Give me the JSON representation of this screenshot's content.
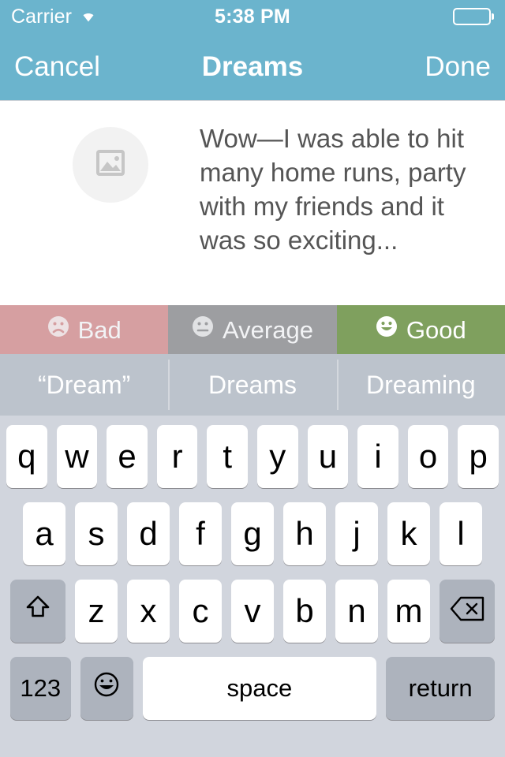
{
  "status_bar": {
    "carrier": "Carrier",
    "wifi_icon": "wifi-icon",
    "time": "5:38 PM",
    "battery_icon": "battery-full-icon",
    "background_color": "#6bb4cd"
  },
  "nav_bar": {
    "cancel_label": "Cancel",
    "title": "Dreams",
    "done_label": "Done",
    "background_color": "#6bb4cd"
  },
  "entry": {
    "avatar_icon": "photo-placeholder-icon",
    "text": "Wow—I was able to hit many home runs, party with my friends and it was so exciting..."
  },
  "rating_bar": {
    "options": [
      {
        "label": "Bad",
        "face": "frowning-face",
        "color": "#d98b8b",
        "selected": false
      },
      {
        "label": "Average",
        "face": "neutral-face",
        "color": "#8a8a8a",
        "selected": false
      },
      {
        "label": "Good",
        "face": "smiling-face",
        "color": "#7fa05e",
        "selected": true
      }
    ]
  },
  "suggestions": {
    "background_color": "#bcc3cc",
    "items": [
      "“Dream”",
      "Dreams",
      "Dreaming"
    ]
  },
  "keyboard": {
    "background_color": "#d1d5dd",
    "row1": [
      "q",
      "w",
      "e",
      "r",
      "t",
      "y",
      "u",
      "i",
      "o",
      "p"
    ],
    "row2": [
      "a",
      "s",
      "d",
      "f",
      "g",
      "h",
      "j",
      "k",
      "l"
    ],
    "row3": [
      "z",
      "x",
      "c",
      "v",
      "b",
      "n",
      "m"
    ],
    "shift_icon": "shift-arrow-icon",
    "backspace_icon": "backspace-delete-icon",
    "numeric_label": "123",
    "emoji_icon": "smiley-face-icon",
    "space_label": "space",
    "return_label": "return"
  }
}
